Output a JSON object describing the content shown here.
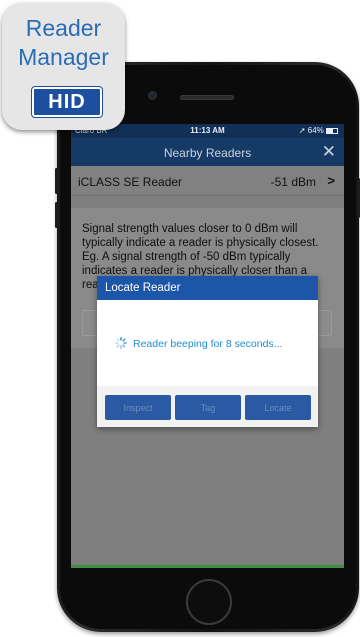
{
  "app_icon": {
    "line1": "Reader",
    "line2": "Manager",
    "logo_text": "HID"
  },
  "status_bar": {
    "carrier": "Claro BR",
    "time": "11:13 AM",
    "battery": "64%"
  },
  "nav": {
    "title": "Nearby Readers",
    "close_icon": "close-icon"
  },
  "reader": {
    "name": "iCLASS SE Reader",
    "signal": "-51 dBm",
    "chevron_icon": "chevron-right-icon"
  },
  "info": {
    "text": "Signal strength values closer to 0 dBm will typically indicate a reader is physically closest. Eg. A signal strength of -50 dBm typically indicates a reader is physically closer than a reader with a -90 dBm signal strength."
  },
  "modal": {
    "title": "Locate Reader",
    "message": "Reader beeping for 8 seconds...",
    "spinner_icon": "spinner-icon",
    "buttons": [
      {
        "label": "Inspect"
      },
      {
        "label": "Tag"
      },
      {
        "label": "Locate"
      }
    ]
  },
  "colors": {
    "nav_bg": "#163a66",
    "modal_header": "#1c56a8",
    "message_text": "#1f8fd0",
    "app_icon_text": "#2a6cb5",
    "hid_blue": "#1c4fa0"
  }
}
